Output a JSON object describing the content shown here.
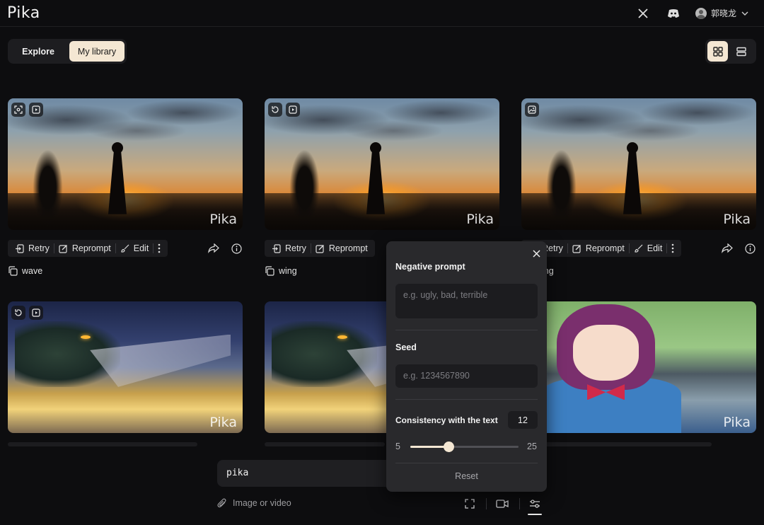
{
  "app": {
    "logo": "Pika"
  },
  "header": {
    "user_name": "郭晓龙"
  },
  "tabs": [
    {
      "label": "Explore"
    },
    {
      "label": "My library"
    }
  ],
  "watermark": "Pika",
  "toolbar": {
    "retry": "Retry",
    "reprompt": "Reprompt",
    "edit": "Edit"
  },
  "cards": [
    {
      "caption": "wave"
    },
    {
      "caption": "wing"
    },
    {
      "caption": "wing"
    }
  ],
  "prompt": {
    "value": "pika",
    "attach_label": "Image or video"
  },
  "options": {
    "negative_prompt_label": "Negative prompt",
    "negative_prompt_placeholder": "e.g. ugly, bad, terrible",
    "seed_label": "Seed",
    "seed_placeholder": "e.g. 1234567890",
    "consistency_label": "Consistency with the text",
    "consistency_value": "12",
    "slider_min": "5",
    "slider_max": "25",
    "reset_label": "Reset"
  },
  "colors": {
    "accent": "#f4e7d3",
    "background": "#0d0d0f",
    "panel": "#29292c"
  }
}
